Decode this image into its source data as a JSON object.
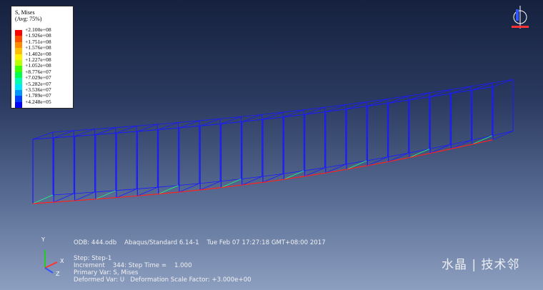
{
  "legend": {
    "title": "S, Mises",
    "subtitle": "(Avg: 75%)",
    "entries": [
      {
        "label": "+2.100e+08",
        "color": "#ff0000"
      },
      {
        "label": "+1.926e+08",
        "color": "#ff4d00"
      },
      {
        "label": "+1.751e+08",
        "color": "#ff8c00"
      },
      {
        "label": "+1.576e+08",
        "color": "#ffbf00"
      },
      {
        "label": "+1.402e+08",
        "color": "#fff200"
      },
      {
        "label": "+1.227e+08",
        "color": "#b8ff00"
      },
      {
        "label": "+1.052e+08",
        "color": "#3cff00"
      },
      {
        "label": "+8.776e+07",
        "color": "#00ff4d"
      },
      {
        "label": "+7.029e+07",
        "color": "#00ffb3"
      },
      {
        "label": "+5.282e+07",
        "color": "#00e6ff"
      },
      {
        "label": "+3.536e+07",
        "color": "#0096ff"
      },
      {
        "label": "+1.789e+07",
        "color": "#0040ff"
      },
      {
        "label": "+4.248e+05",
        "color": "#0000ff"
      }
    ]
  },
  "info": {
    "odb": "ODB: 444.odb    Abaqus/Standard 6.14-1    Tue Feb 07 17:27:18 GMT+08:00 2017",
    "step": "Step: Step-1",
    "increment": "Increment    344: Step Time =    1.000",
    "primary": "Primary Var: S, Mises",
    "deformed": "Deformed Var: U   Deformation Scale Factor: +3.000e+00"
  },
  "triad": {
    "x": "X",
    "y": "Y",
    "z": "Z"
  },
  "watermark": "水晶 | 技术邻",
  "colors": {
    "frame": "#1a1aff",
    "accent_red": "#ff2020"
  }
}
